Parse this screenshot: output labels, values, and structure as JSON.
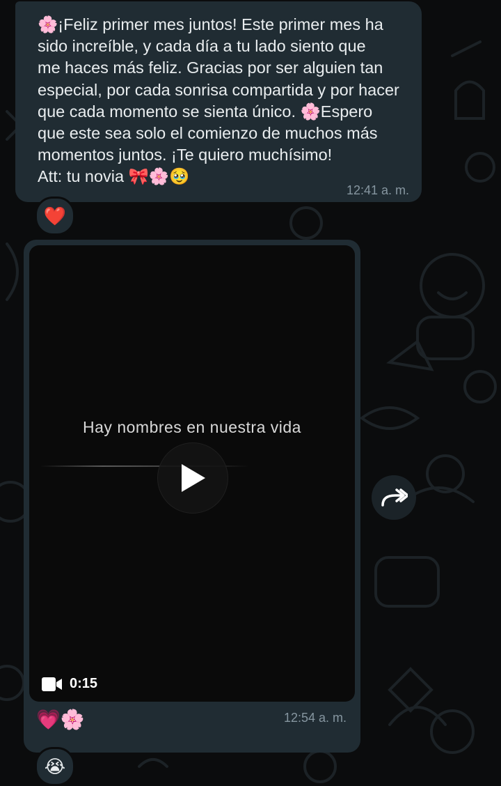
{
  "message1": {
    "text": "🌸¡Feliz primer mes juntos! Este primer mes ha\nsido increíble, y cada día a tu lado siento que\nme haces más feliz. Gracias por ser alguien tan\nespecial, por cada sonrisa compartida y por hacer\nque cada momento se sienta único. 🌸Espero\nque este sea solo el comienzo de muchos más\nmomentos juntos. ¡Te quiero muchísimo!\nAtt: tu novia 🎀🌸🥹",
    "time": "12:41 a. m.",
    "reaction": "❤️"
  },
  "message2": {
    "video_caption": "Hay nombres en nuestra vida",
    "duration": "0:15",
    "emojis": "💗🌸",
    "time": "12:54 a. m.",
    "reaction": "😭"
  },
  "icons": {
    "play": "play-icon",
    "video": "video-camera-icon",
    "forward": "forward-icon"
  },
  "colors": {
    "bubble": "#202c33",
    "background": "#0b0c0d",
    "timestamp": "#8696a0"
  }
}
